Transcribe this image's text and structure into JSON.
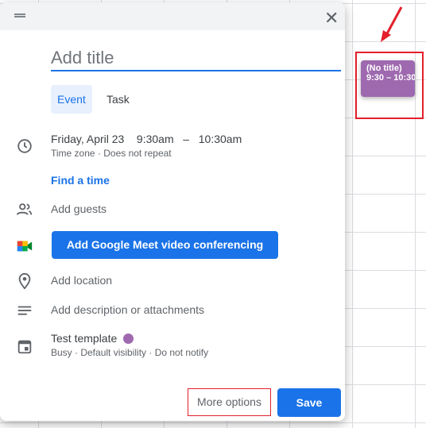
{
  "dialog": {
    "title_placeholder": "Add title",
    "tabs": [
      {
        "label": "Event",
        "active": true
      },
      {
        "label": "Task",
        "active": false
      }
    ],
    "datetime": {
      "date": "Friday, April 23",
      "start": "9:30am",
      "sep": "–",
      "end": "10:30am",
      "details": "Time zone · Does not repeat"
    },
    "find_time": "Find a time",
    "add_guests": "Add guests",
    "meet_button": "Add Google Meet video conferencing",
    "add_location": "Add location",
    "add_description": "Add description or attachments",
    "calendar": {
      "name": "Test template",
      "color": "#9e69af",
      "details": "Busy · Default visibility · Do not notify"
    },
    "more_options": "More options",
    "save": "Save"
  },
  "calendar_event": {
    "title": "(No title)",
    "time": "9:30 – 10:30"
  },
  "colors": {
    "accent": "#1a73e8",
    "event": "#9e69af",
    "highlight": "#e3202b"
  }
}
